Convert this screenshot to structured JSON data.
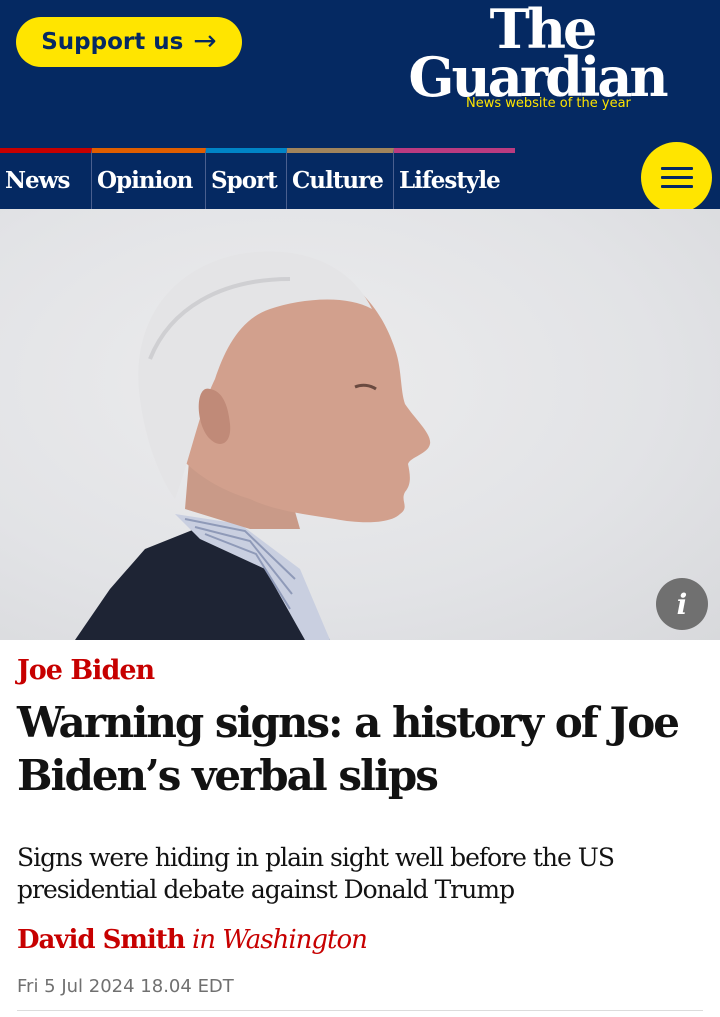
{
  "header": {
    "support_label": "Support us",
    "support_arrow": "→",
    "logo_line1": "The",
    "logo_line2": "Guardian",
    "tagline": "News website of the year",
    "brand_color": "#052962",
    "accent_color": "#ffe500"
  },
  "nav": {
    "items": [
      {
        "label": "News",
        "pillar_color": "#c70000"
      },
      {
        "label": "Opinion",
        "pillar_color": "#e05e00"
      },
      {
        "label": "Sport",
        "pillar_color": "#0084c6"
      },
      {
        "label": "Culture",
        "pillar_color": "#a1845c"
      },
      {
        "label": "Lifestyle",
        "pillar_color": "#bb3b80"
      }
    ],
    "menu_icon": "hamburger-icon"
  },
  "hero": {
    "info_label": "i",
    "info_icon": "info-icon"
  },
  "article": {
    "kicker": "Joe Biden",
    "headline": "Warning signs: a history of Joe Biden’s verbal slips",
    "standfirst": "Signs were hiding in plain sight well before the US presidential debate against Donald Trump",
    "author": "David Smith",
    "location": "in Washington",
    "date": "Fri 5 Jul 2024 18.04 EDT",
    "kicker_color": "#c70000"
  }
}
